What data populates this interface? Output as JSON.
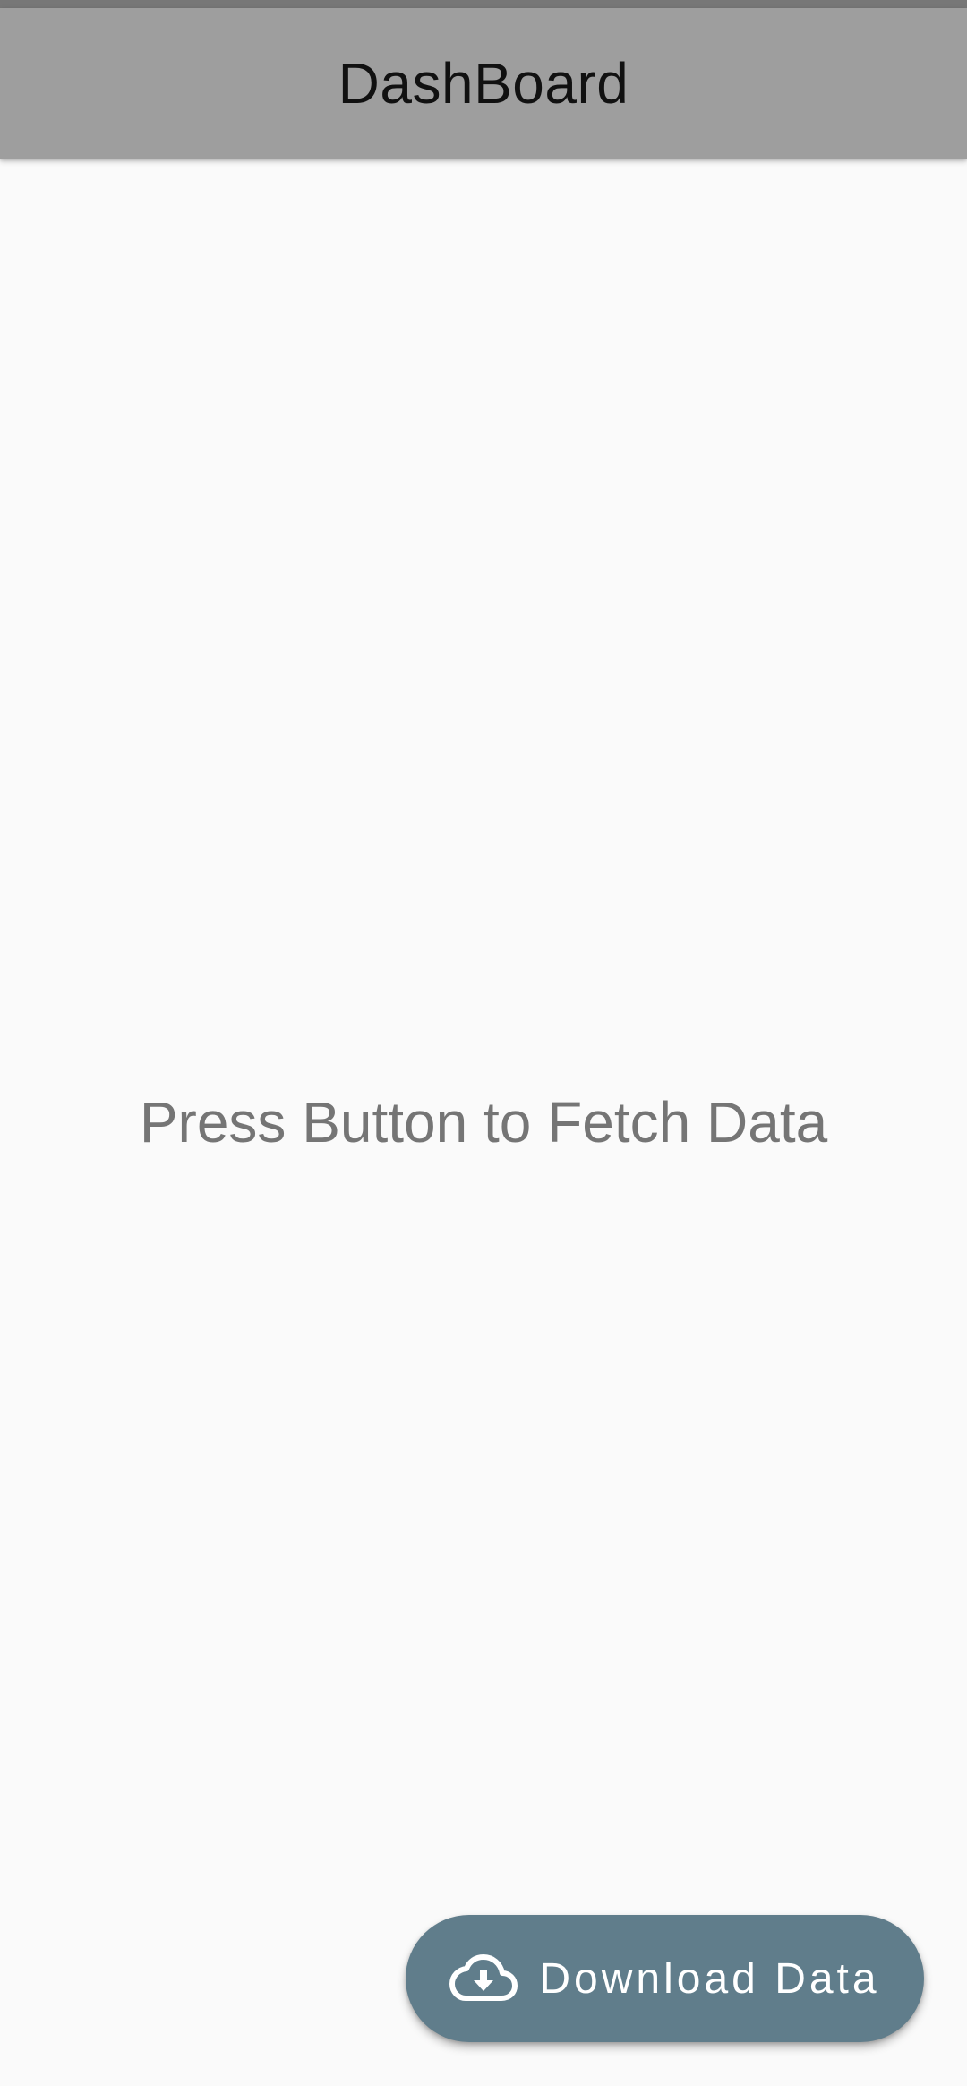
{
  "app_bar": {
    "title": "DashBoard"
  },
  "main": {
    "placeholder_text": "Press Button to Fetch Data"
  },
  "fab": {
    "label": "Download Data",
    "icon": "cloud-download-icon"
  },
  "colors": {
    "status_bar": "#777777",
    "app_bar": "#9e9e9e",
    "background": "#fafafa",
    "placeholder_text": "#757575",
    "fab": "#607d8b",
    "fab_text": "#ffffff"
  }
}
